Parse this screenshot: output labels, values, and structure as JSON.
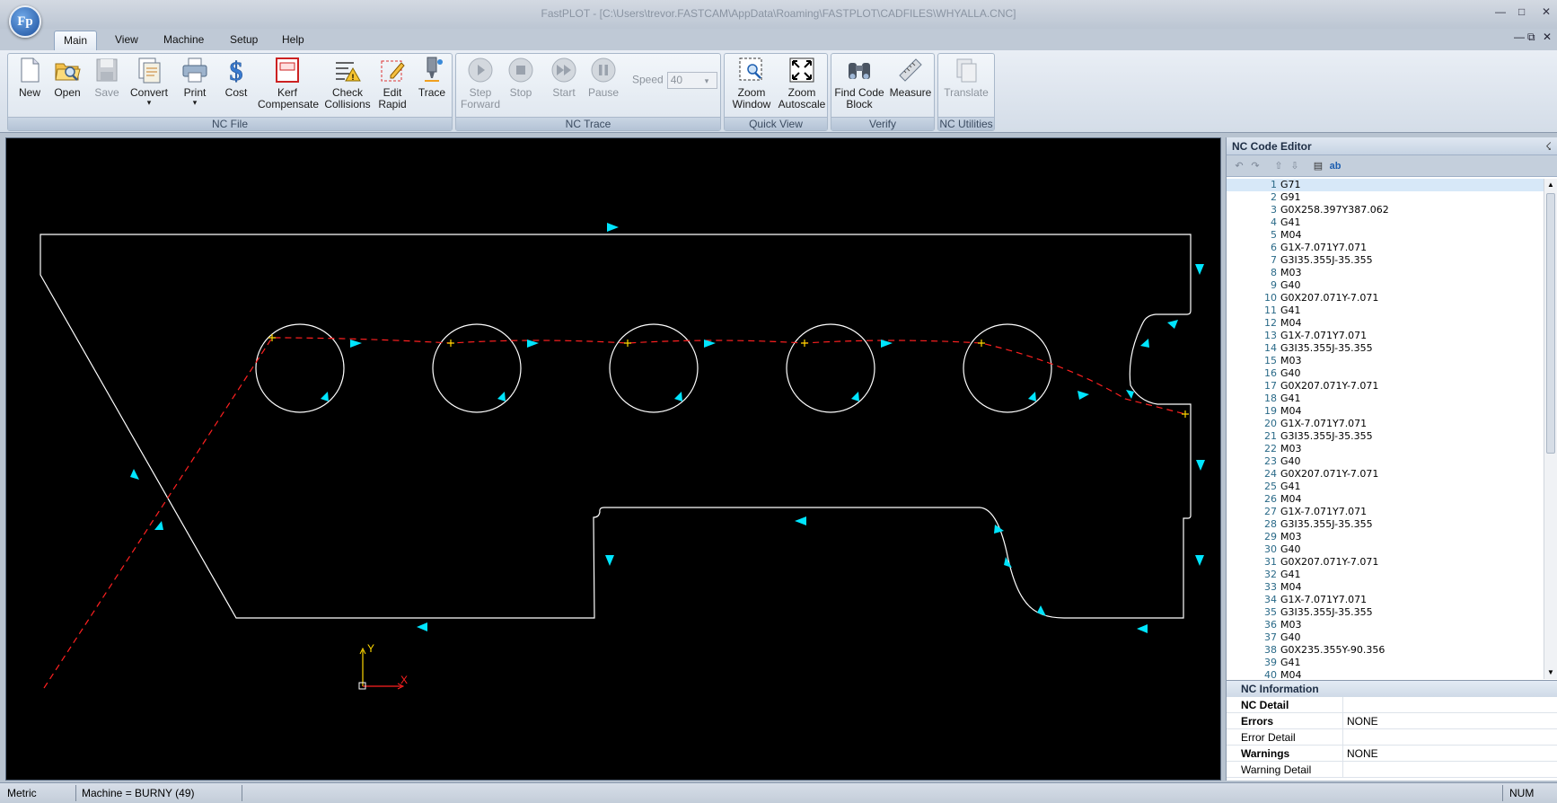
{
  "window": {
    "title": "FastPLOT - [C:\\Users\\trevor.FASTCAM\\AppData\\Roaming\\FASTPLOT\\CADFILES\\WHYALLA.CNC]",
    "logo": "Fp"
  },
  "menu": {
    "tabs": [
      "Main",
      "View",
      "Machine",
      "Setup",
      "Help"
    ],
    "active": "Main"
  },
  "ribbon": {
    "nc_file": {
      "title": "NC File",
      "new": "New",
      "open": "Open",
      "save": "Save",
      "convert": "Convert",
      "print": "Print",
      "cost": "Cost",
      "kerf": "Kerf Compensate",
      "check": "Check Collisions",
      "edit_rapid": "Edit Rapid",
      "trace": "Trace"
    },
    "nc_trace": {
      "title": "NC Trace",
      "step_forward": "Step Forward",
      "stop": "Stop",
      "start": "Start",
      "pause": "Pause",
      "speed_label": "Speed",
      "speed_value": "40"
    },
    "quick_view": {
      "title": "Quick View",
      "zoom_window": "Zoom Window",
      "zoom_autoscale": "Zoom Autoscale"
    },
    "verify": {
      "title": "Verify",
      "find_code": "Find Code Block",
      "measure": "Measure"
    },
    "nc_utilities": {
      "title": "NC Utilities",
      "translate": "Translate"
    }
  },
  "canvas": {
    "axis_x": "X",
    "axis_y": "Y",
    "colors": {
      "cut": "#ffffff",
      "rapid": "#ff2020",
      "arrow": "#00e5ff",
      "marker": "#ffd700"
    }
  },
  "editor": {
    "title": "NC Code Editor",
    "lines": [
      {
        "n": "1",
        "code": "G71"
      },
      {
        "n": "2",
        "code": "G91"
      },
      {
        "n": "3",
        "code": "G0X258.397Y387.062"
      },
      {
        "n": "4",
        "code": "G41"
      },
      {
        "n": "5",
        "code": "M04"
      },
      {
        "n": "6",
        "code": "G1X-7.071Y7.071"
      },
      {
        "n": "7",
        "code": "G3I35.355J-35.355"
      },
      {
        "n": "8",
        "code": "M03"
      },
      {
        "n": "9",
        "code": "G40"
      },
      {
        "n": "10",
        "code": "G0X207.071Y-7.071"
      },
      {
        "n": "11",
        "code": "G41"
      },
      {
        "n": "12",
        "code": "M04"
      },
      {
        "n": "13",
        "code": "G1X-7.071Y7.071"
      },
      {
        "n": "14",
        "code": "G3I35.355J-35.355"
      },
      {
        "n": "15",
        "code": "M03"
      },
      {
        "n": "16",
        "code": "G40"
      },
      {
        "n": "17",
        "code": "G0X207.071Y-7.071"
      },
      {
        "n": "18",
        "code": "G41"
      },
      {
        "n": "19",
        "code": "M04"
      },
      {
        "n": "20",
        "code": "G1X-7.071Y7.071"
      },
      {
        "n": "21",
        "code": "G3I35.355J-35.355"
      },
      {
        "n": "22",
        "code": "M03"
      },
      {
        "n": "23",
        "code": "G40"
      },
      {
        "n": "24",
        "code": "G0X207.071Y-7.071"
      },
      {
        "n": "25",
        "code": "G41"
      },
      {
        "n": "26",
        "code": "M04"
      },
      {
        "n": "27",
        "code": "G1X-7.071Y7.071"
      },
      {
        "n": "28",
        "code": "G3I35.355J-35.355"
      },
      {
        "n": "29",
        "code": "M03"
      },
      {
        "n": "30",
        "code": "G40"
      },
      {
        "n": "31",
        "code": "G0X207.071Y-7.071"
      },
      {
        "n": "32",
        "code": "G41"
      },
      {
        "n": "33",
        "code": "M04"
      },
      {
        "n": "34",
        "code": "G1X-7.071Y7.071"
      },
      {
        "n": "35",
        "code": "G3I35.355J-35.355"
      },
      {
        "n": "36",
        "code": "M03"
      },
      {
        "n": "37",
        "code": "G40"
      },
      {
        "n": "38",
        "code": "G0X235.355Y-90.356"
      },
      {
        "n": "39",
        "code": "G41"
      },
      {
        "n": "40",
        "code": "M04"
      }
    ]
  },
  "nc_info": {
    "title": "NC Information",
    "rows": [
      {
        "label": "NC Detail",
        "value": "",
        "bold": true
      },
      {
        "label": "Errors",
        "value": "NONE",
        "bold": true
      },
      {
        "label": "Error Detail",
        "value": "",
        "bold": false
      },
      {
        "label": "Warnings",
        "value": "NONE",
        "bold": true
      },
      {
        "label": "Warning Detail",
        "value": "",
        "bold": false
      }
    ]
  },
  "status": {
    "units": "Metric",
    "machine": "Machine = BURNY (49)",
    "num": "NUM"
  }
}
